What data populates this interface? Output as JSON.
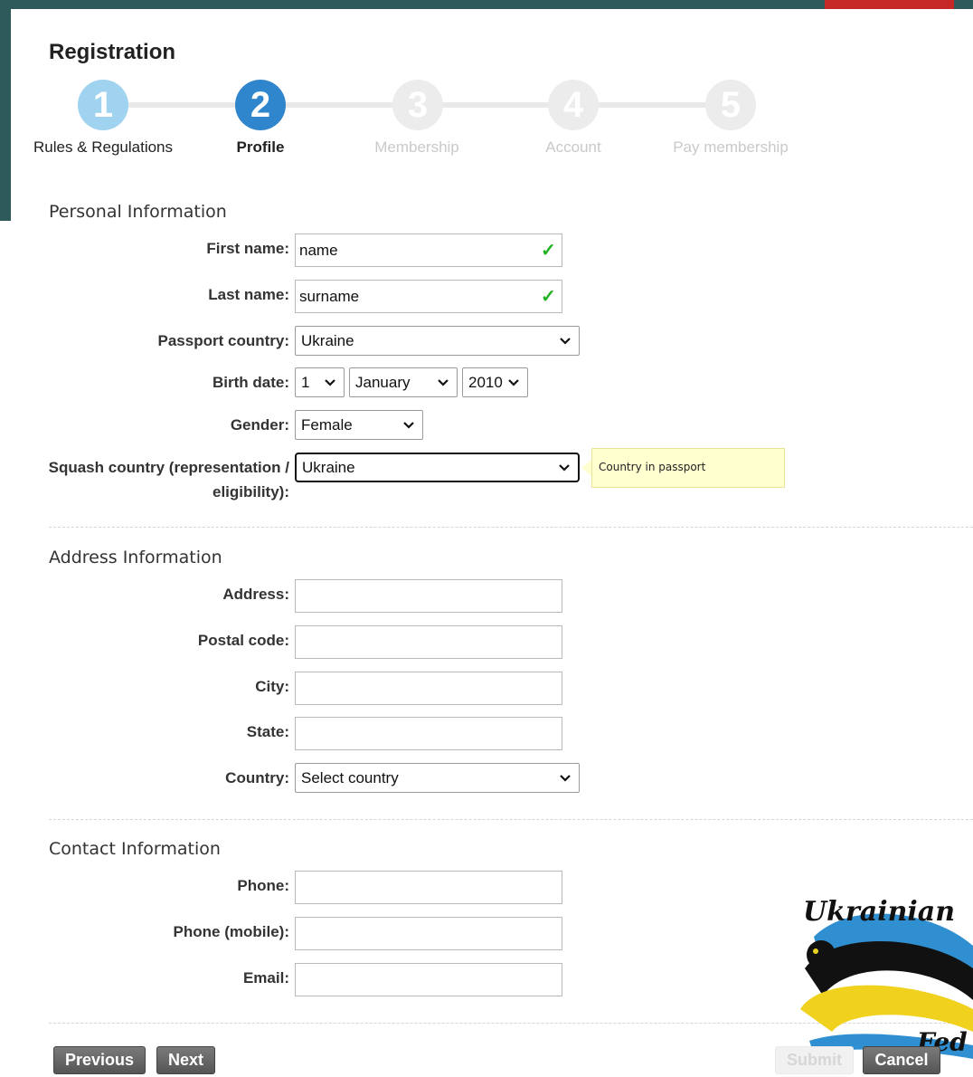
{
  "page": {
    "title": "Registration"
  },
  "steps": [
    {
      "number": "1",
      "label": "Rules & Regulations",
      "state": "done"
    },
    {
      "number": "2",
      "label": "Profile",
      "state": "active"
    },
    {
      "number": "3",
      "label": "Membership",
      "state": "pending"
    },
    {
      "number": "4",
      "label": "Account",
      "state": "pending"
    },
    {
      "number": "5",
      "label": "Pay membership",
      "state": "pending"
    }
  ],
  "personal": {
    "title": "Personal Information",
    "first_name": {
      "label": "First name:",
      "value": "name",
      "valid": true
    },
    "last_name": {
      "label": "Last name:",
      "value": "surname",
      "valid": true
    },
    "passport_country": {
      "label": "Passport country:",
      "value": "Ukraine"
    },
    "birth_date": {
      "label": "Birth date:",
      "day": "1",
      "month": "January",
      "year": "2010"
    },
    "gender": {
      "label": "Gender:",
      "value": "Female"
    },
    "squash_country": {
      "label": "Squash country (representation / eligibility):",
      "value": "Ukraine",
      "tooltip": "Country in passport"
    }
  },
  "address": {
    "title": "Address Information",
    "address": {
      "label": "Address:",
      "value": ""
    },
    "postal_code": {
      "label": "Postal code:",
      "value": ""
    },
    "city": {
      "label": "City:",
      "value": ""
    },
    "state": {
      "label": "State:",
      "value": ""
    },
    "country": {
      "label": "Country:",
      "value": "Select country"
    }
  },
  "contact": {
    "title": "Contact Information",
    "phone": {
      "label": "Phone:",
      "value": ""
    },
    "phone_mobile": {
      "label": "Phone (mobile):",
      "value": ""
    },
    "email": {
      "label": "Email:",
      "value": ""
    }
  },
  "buttons": {
    "previous": "Previous",
    "next": "Next",
    "submit": "Submit",
    "cancel": "Cancel"
  },
  "logo": {
    "text": "Ukrainian",
    "text2": "Fed"
  },
  "colors": {
    "header": "#2e5a5c",
    "active_step": "#2f86cd",
    "done_step": "#9fd3ef",
    "valid_check": "#22b322",
    "tooltip_bg": "#ffffd0"
  }
}
